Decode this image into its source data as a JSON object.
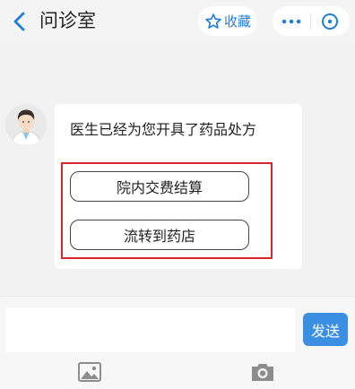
{
  "header": {
    "title": "问诊室",
    "favorite_label": "收藏"
  },
  "message": {
    "text": "医生已经为您开具了药品处方",
    "actions": [
      {
        "label": "院内交费结算"
      },
      {
        "label": "流转到药店"
      }
    ]
  },
  "composer": {
    "input_placeholder": "",
    "send_label": "发送"
  },
  "icons": {
    "back": "chevron-left-icon",
    "favorite": "star-icon",
    "more": "ellipsis-icon",
    "close": "close-circle-icon",
    "doctor": "doctor-avatar",
    "image": "image-icon",
    "camera": "camera-icon"
  },
  "colors": {
    "accent": "#1f7fd8",
    "send_button": "#3a8fe3",
    "highlight_box": "#d8272b",
    "background": "#f2f2f2"
  }
}
